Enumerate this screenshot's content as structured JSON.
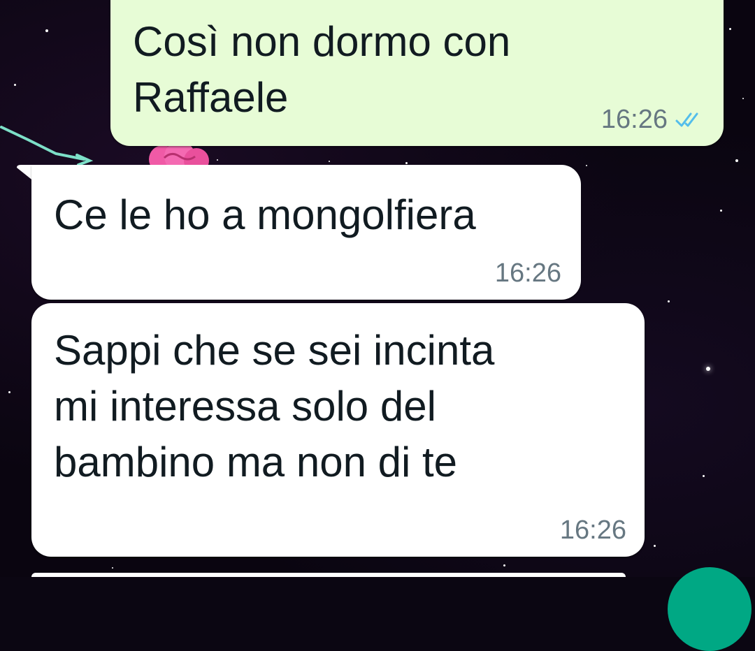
{
  "messages": [
    {
      "direction": "outgoing",
      "text": "Così non dormo con\nRaffaele",
      "time": "16:26",
      "status": "read",
      "status_icon": "double-check-icon",
      "tick_color": "#53bdeb"
    },
    {
      "direction": "incoming",
      "text": "Ce le ho a mongolfiera",
      "time": "16:26"
    },
    {
      "direction": "incoming",
      "text": "Sappi che se sei incinta\nmi interessa solo del\nbambino ma non di te",
      "time": "16:26"
    }
  ],
  "colors": {
    "outgoing_bubble": "#e7fcd6",
    "incoming_bubble": "#ffffff",
    "accent": "#00a884",
    "wallpaper": "#0a0510"
  }
}
